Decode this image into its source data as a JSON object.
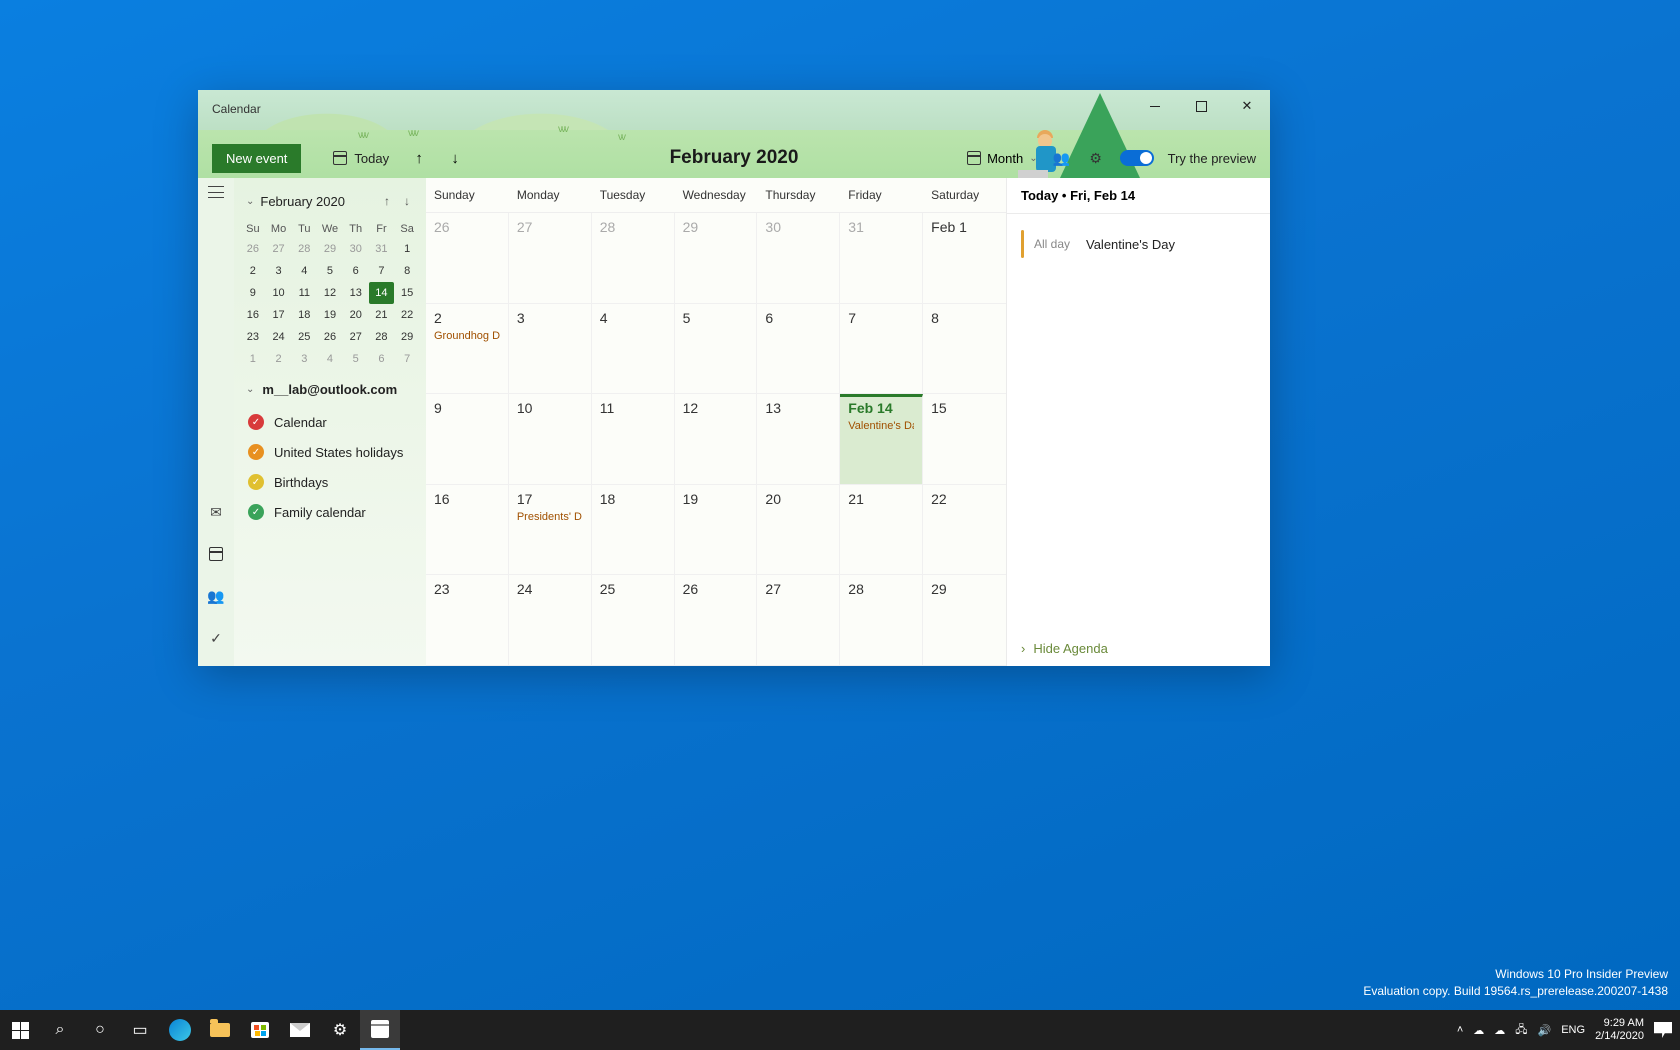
{
  "window": {
    "title": "Calendar"
  },
  "toolbar": {
    "new_event": "New event",
    "today": "Today",
    "month_title": "February 2020",
    "view_label": "Month",
    "try_preview": "Try the preview"
  },
  "mini_cal": {
    "title": "February 2020",
    "dow": [
      "Su",
      "Mo",
      "Tu",
      "We",
      "Th",
      "Fr",
      "Sa"
    ],
    "rows": [
      [
        {
          "n": "26",
          "dim": true
        },
        {
          "n": "27",
          "dim": true
        },
        {
          "n": "28",
          "dim": true
        },
        {
          "n": "29",
          "dim": true
        },
        {
          "n": "30",
          "dim": true
        },
        {
          "n": "31",
          "dim": true
        },
        {
          "n": "1"
        }
      ],
      [
        {
          "n": "2"
        },
        {
          "n": "3"
        },
        {
          "n": "4"
        },
        {
          "n": "5"
        },
        {
          "n": "6"
        },
        {
          "n": "7"
        },
        {
          "n": "8"
        }
      ],
      [
        {
          "n": "9"
        },
        {
          "n": "10"
        },
        {
          "n": "11"
        },
        {
          "n": "12"
        },
        {
          "n": "13"
        },
        {
          "n": "14",
          "today": true
        },
        {
          "n": "15"
        }
      ],
      [
        {
          "n": "16"
        },
        {
          "n": "17"
        },
        {
          "n": "18"
        },
        {
          "n": "19"
        },
        {
          "n": "20"
        },
        {
          "n": "21"
        },
        {
          "n": "22"
        }
      ],
      [
        {
          "n": "23"
        },
        {
          "n": "24"
        },
        {
          "n": "25"
        },
        {
          "n": "26"
        },
        {
          "n": "27"
        },
        {
          "n": "28"
        },
        {
          "n": "29"
        }
      ],
      [
        {
          "n": "1",
          "dim": true
        },
        {
          "n": "2",
          "dim": true
        },
        {
          "n": "3",
          "dim": true
        },
        {
          "n": "4",
          "dim": true
        },
        {
          "n": "5",
          "dim": true
        },
        {
          "n": "6",
          "dim": true
        },
        {
          "n": "7",
          "dim": true
        }
      ]
    ]
  },
  "account": {
    "email": "m__lab@outlook.com"
  },
  "calendars": [
    {
      "name": "Calendar",
      "color": "#d83b3b"
    },
    {
      "name": "United States holidays",
      "color": "#e89020"
    },
    {
      "name": "Birthdays",
      "color": "#e0c030"
    },
    {
      "name": "Family calendar",
      "color": "#3aa35a"
    }
  ],
  "dow_full": [
    "Sunday",
    "Monday",
    "Tuesday",
    "Wednesday",
    "Thursday",
    "Friday",
    "Saturday"
  ],
  "weeks": [
    [
      {
        "n": "26",
        "dim": true
      },
      {
        "n": "27",
        "dim": true
      },
      {
        "n": "28",
        "dim": true
      },
      {
        "n": "29",
        "dim": true
      },
      {
        "n": "30",
        "dim": true
      },
      {
        "n": "31",
        "dim": true
      },
      {
        "n": "Feb 1"
      }
    ],
    [
      {
        "n": "2",
        "event": "Groundhog D"
      },
      {
        "n": "3"
      },
      {
        "n": "4"
      },
      {
        "n": "5"
      },
      {
        "n": "6"
      },
      {
        "n": "7"
      },
      {
        "n": "8"
      }
    ],
    [
      {
        "n": "9"
      },
      {
        "n": "10"
      },
      {
        "n": "11"
      },
      {
        "n": "12"
      },
      {
        "n": "13"
      },
      {
        "n": "Feb 14",
        "today": true,
        "event": "Valentine's Da"
      },
      {
        "n": "15"
      }
    ],
    [
      {
        "n": "16"
      },
      {
        "n": "17",
        "event": "Presidents' D"
      },
      {
        "n": "18"
      },
      {
        "n": "19"
      },
      {
        "n": "20"
      },
      {
        "n": "21"
      },
      {
        "n": "22"
      }
    ],
    [
      {
        "n": "23"
      },
      {
        "n": "24"
      },
      {
        "n": "25"
      },
      {
        "n": "26"
      },
      {
        "n": "27"
      },
      {
        "n": "28"
      },
      {
        "n": "29"
      }
    ]
  ],
  "agenda": {
    "header": "Today • Fri, Feb 14",
    "items": [
      {
        "time": "All day",
        "title": "Valentine's Day"
      }
    ],
    "hide": "Hide Agenda"
  },
  "watermark": {
    "line1": "Windows 10 Pro Insider Preview",
    "line2": "Evaluation copy. Build 19564.rs_prerelease.200207-1438"
  },
  "taskbar": {
    "lang": "ENG",
    "time": "9:29 AM",
    "date": "2/14/2020"
  }
}
